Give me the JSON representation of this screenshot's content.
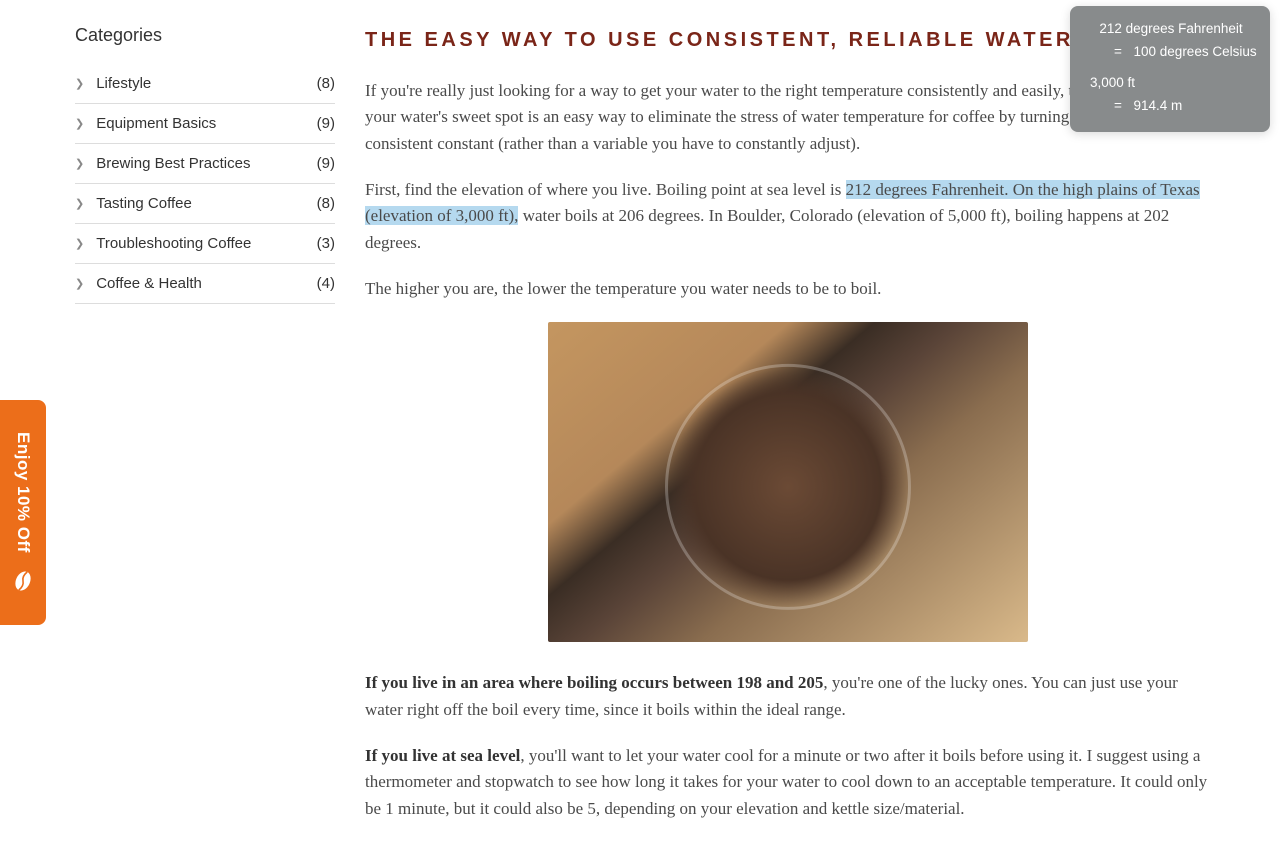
{
  "sidebar": {
    "title": "Categories",
    "items": [
      {
        "label": "Lifestyle",
        "count": "(8)"
      },
      {
        "label": "Equipment Basics",
        "count": "(9)"
      },
      {
        "label": "Brewing Best Practices",
        "count": "(9)"
      },
      {
        "label": "Tasting Coffee",
        "count": "(8)"
      },
      {
        "label": "Troubleshooting Coffee",
        "count": "(3)"
      },
      {
        "label": "Coffee & Health",
        "count": "(4)"
      }
    ]
  },
  "article": {
    "title": "THE EASY WAY TO USE CONSISTENT, RELIABLE WATER",
    "p1": "If you're really just looking for a way to get your water to the right temperature consistently and easily, that's great! Finding your water's sweet spot is an easy way to eliminate the stress of water temperature for coffee by turning it into a reliable, consistent constant (rather than a variable you have to constantly adjust).",
    "p2_pre": "First, find the elevation of where you live. Boiling point at sea level is ",
    "p2_highlight": "212 degrees Fahrenheit. On the high plains of Texas (elevation of 3,000 ft),",
    "p2_post": " water boils at 206 degrees. In Boulder, Colorado (elevation of 5,000 ft), boiling happens at 202 degrees.",
    "p3": "The higher you are, the lower the temperature you water needs to be to boil.",
    "p4_bold": "If you live in an area where boiling occurs between 198 and 205",
    "p4_rest": ", you're one of the lucky ones.  You can just use your water right off the boil every time, since it boils within the ideal range.",
    "p5_bold": "If you live at sea level",
    "p5_rest": ", you'll want to let your water cool for a minute or two after it boils before using it. I suggest using a thermometer and stopwatch to see how long it takes for your water to cool down to an acceptable temperature. It could only be 1 minute, but it could also be 5, depending on your elevation and kettle size/material."
  },
  "promo": {
    "label": "Enjoy 10% Off"
  },
  "tooltip": {
    "line1": "212 degrees Fahrenheit",
    "line2": "100 degrees Celsius",
    "line3": "3,000 ft",
    "line4": "914.4 m"
  }
}
